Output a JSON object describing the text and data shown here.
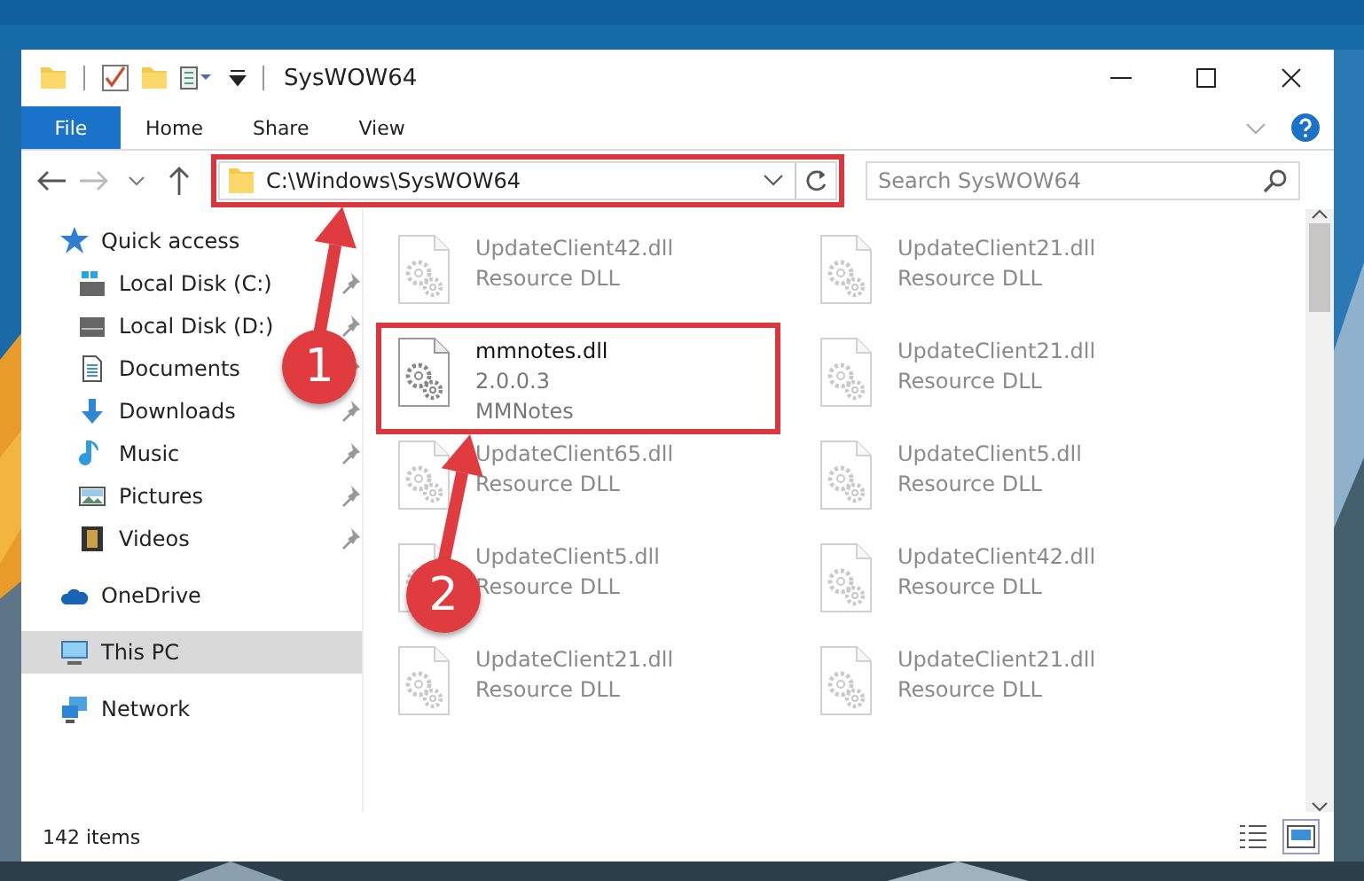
{
  "window": {
    "title": "SysWOW64"
  },
  "ribbon": {
    "tabs": [
      {
        "label": "File",
        "kind": "file"
      },
      {
        "label": "Home",
        "kind": "tab"
      },
      {
        "label": "Share",
        "kind": "tab"
      },
      {
        "label": "View",
        "kind": "tab"
      }
    ]
  },
  "address": {
    "path": "C:\\Windows\\SysWOW64"
  },
  "search": {
    "placeholder": "Search SysWOW64"
  },
  "sidebar": {
    "items": [
      {
        "label": "Quick access",
        "children": [
          {
            "label": "Local Disk (C:)",
            "pinned": true
          },
          {
            "label": "Local Disk (D:)",
            "pinned": true
          },
          {
            "label": "Documents",
            "pinned": true
          },
          {
            "label": "Downloads",
            "pinned": true
          },
          {
            "label": "Music",
            "pinned": true
          },
          {
            "label": "Pictures",
            "pinned": true
          },
          {
            "label": "Videos",
            "pinned": true
          }
        ]
      },
      {
        "label": "OneDrive",
        "selected": false
      },
      {
        "label": "This PC",
        "selected": true
      },
      {
        "label": "Network",
        "selected": false
      }
    ]
  },
  "files": [
    {
      "name": "UpdateClient42.dll",
      "details": [
        "Resource DLL"
      ],
      "blurred": true
    },
    {
      "name": "UpdateClient21.dll",
      "details": [
        "Resource DLL"
      ],
      "blurred": true
    },
    {
      "name": "mmnotes.dll",
      "details": [
        "2.0.0.3",
        "MMNotes"
      ],
      "blurred": false
    },
    {
      "name": "UpdateClient21.dll",
      "details": [
        "Resource DLL"
      ],
      "blurred": true
    },
    {
      "name": "UpdateClient65.dll",
      "details": [
        "Resource DLL"
      ],
      "blurred": true
    },
    {
      "name": "UpdateClient5.dll",
      "details": [
        "Resource DLL"
      ],
      "blurred": true
    },
    {
      "name": "UpdateClient5.dll",
      "details": [
        "Resource DLL"
      ],
      "blurred": true
    },
    {
      "name": "UpdateClient42.dll",
      "details": [
        "Resource DLL"
      ],
      "blurred": true
    },
    {
      "name": "UpdateClient21.dll",
      "details": [
        "Resource DLL"
      ],
      "blurred": true
    },
    {
      "name": "UpdateClient21.dll",
      "details": [
        "Resource DLL"
      ],
      "blurred": true
    }
  ],
  "status_bar": {
    "text": "142 items",
    "views": [
      {
        "selected": false
      },
      {
        "selected": true
      }
    ]
  },
  "annotations": [
    {
      "label": "1"
    },
    {
      "label": "2"
    }
  ]
}
